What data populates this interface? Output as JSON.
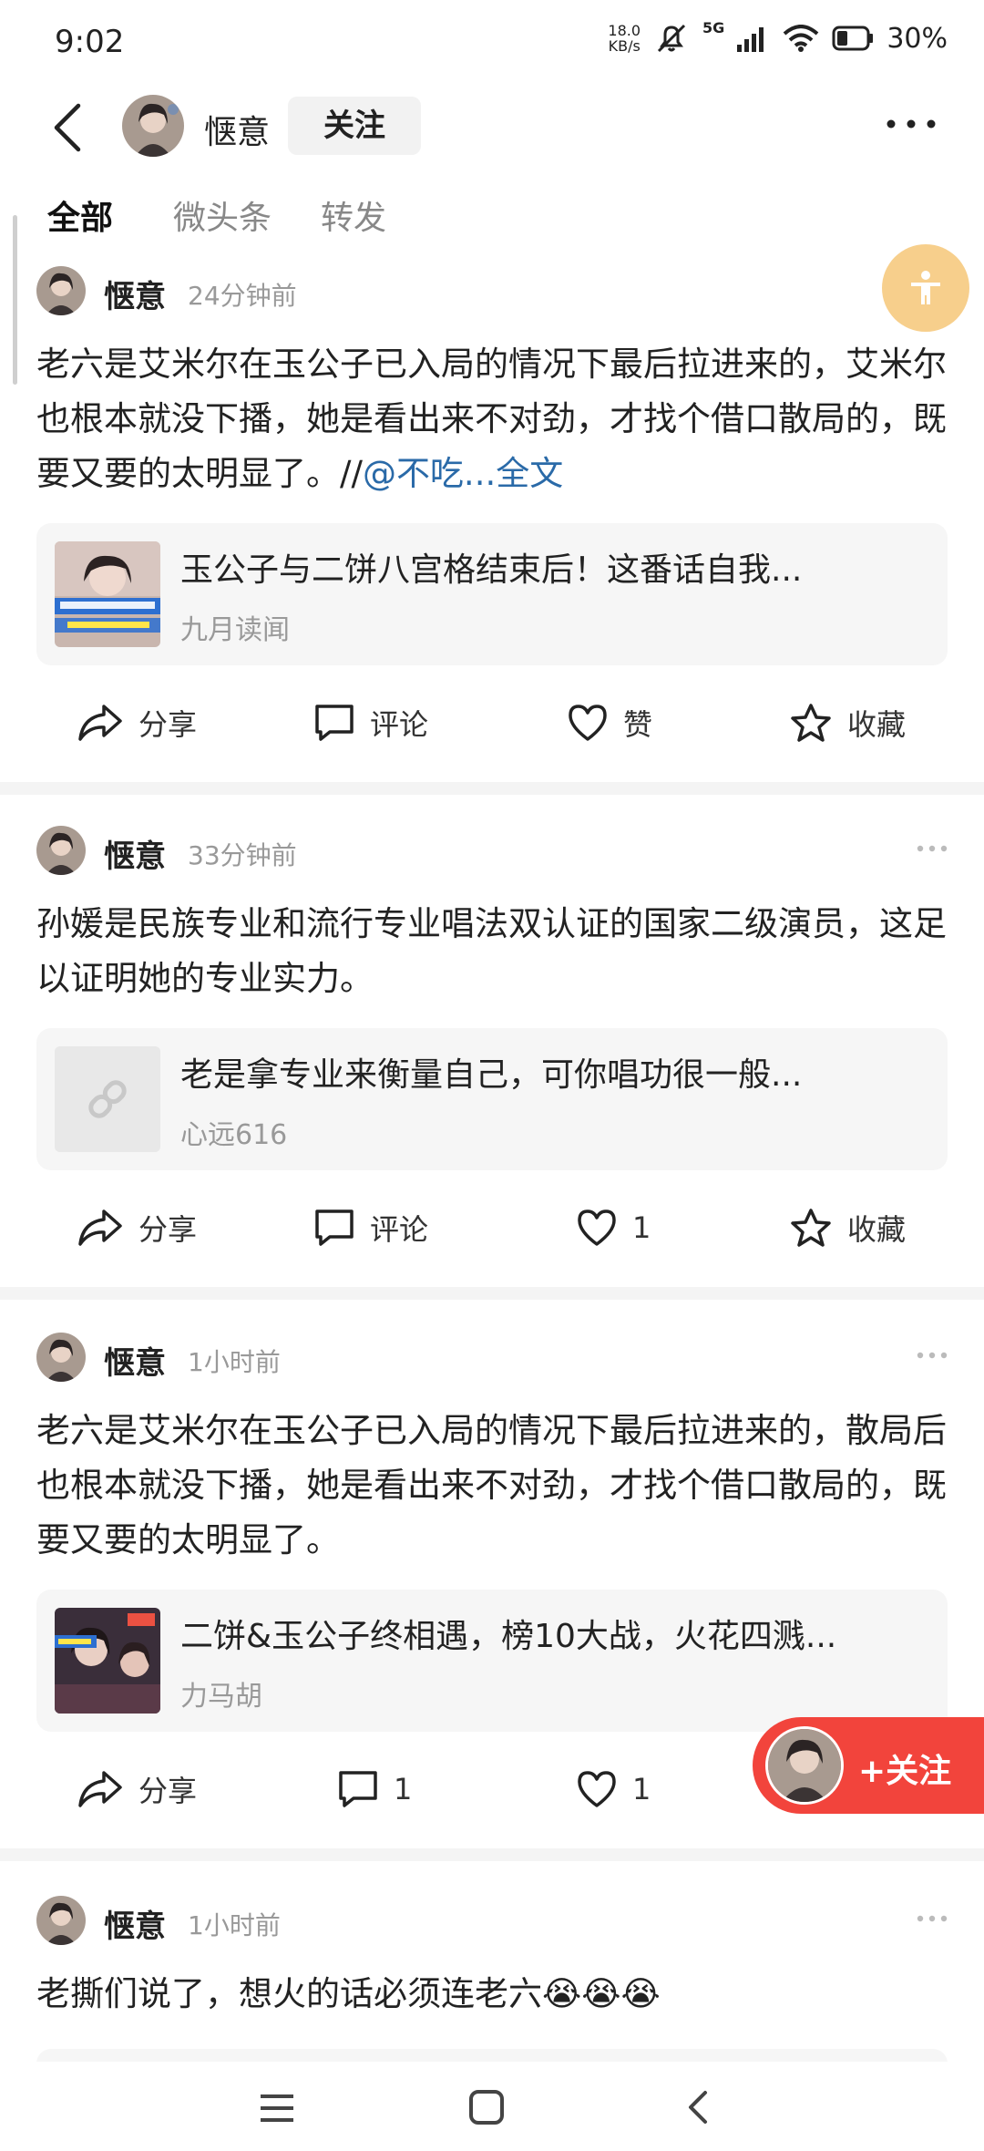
{
  "status_bar": {
    "time": "9:02",
    "net_speed_value": "18.0",
    "net_speed_unit": "KB/s",
    "network": "5G",
    "battery": "30%"
  },
  "header": {
    "name": "惬意",
    "follow_label": "关注"
  },
  "tabs": [
    {
      "label": "全部",
      "active": true
    },
    {
      "label": "微头条",
      "active": false
    },
    {
      "label": "转发",
      "active": false
    }
  ],
  "posts": [
    {
      "author": "惬意",
      "time": "24分钟前",
      "text": "老六是艾米尔在玉公子已入局的情况下最后拉进来的，艾米尔也根本就没下播，她是看出来不对劲，才找个借口散局的，既要又要的太明显了。//",
      "mention": "@不吃...",
      "full_text_link": "全文",
      "card": {
        "title": "玉公子与二饼八宫格结束后！这番话自我...",
        "source": "九月读闻",
        "thumb_type": "video"
      },
      "actions": {
        "share": "分享",
        "comment": "评论",
        "like": "赞",
        "favorite": "收藏"
      }
    },
    {
      "author": "惬意",
      "time": "33分钟前",
      "text": "孙媛是民族专业和流行专业唱法双认证的国家二级演员，这足以证明她的专业实力。",
      "card": {
        "title": "老是拿专业来衡量自己，可你唱功很一般...",
        "source": "心远616",
        "thumb_type": "link"
      },
      "actions": {
        "share": "分享",
        "comment": "评论",
        "like": "1",
        "favorite": "收藏"
      }
    },
    {
      "author": "惬意",
      "time": "1小时前",
      "text": "老六是艾米尔在玉公子已入局的情况下最后拉进来的，散局后也根本就没下播，她是看出来不对劲，才找个借口散局的，既要又要的太明显了。",
      "card": {
        "title": "二饼&玉公子终相遇，榜10大战，火花四溅...",
        "source": "力马胡",
        "thumb_type": "video2"
      },
      "actions": {
        "share": "分享",
        "comment": "1",
        "like": "1"
      }
    },
    {
      "author": "惬意",
      "time": "1小时前",
      "text": "老撕们说了，想火的话必须连老六",
      "emoji": "😭😭😭"
    }
  ],
  "floating_follow": {
    "label": "+关注"
  },
  "icons": {
    "back": "back-arrow-icon",
    "more": "more-dots-icon",
    "accessibility": "accessibility-icon",
    "share": "share-icon",
    "comment": "comment-icon",
    "like": "heart-icon",
    "favorite": "star-icon",
    "nav_menu": "menu-icon",
    "nav_home": "home-square-icon",
    "nav_back": "nav-back-icon"
  },
  "colors": {
    "accent_red": "#f2443c",
    "link_blue": "#2a6aa8",
    "accessibility_bg": "#f7cf8c"
  }
}
